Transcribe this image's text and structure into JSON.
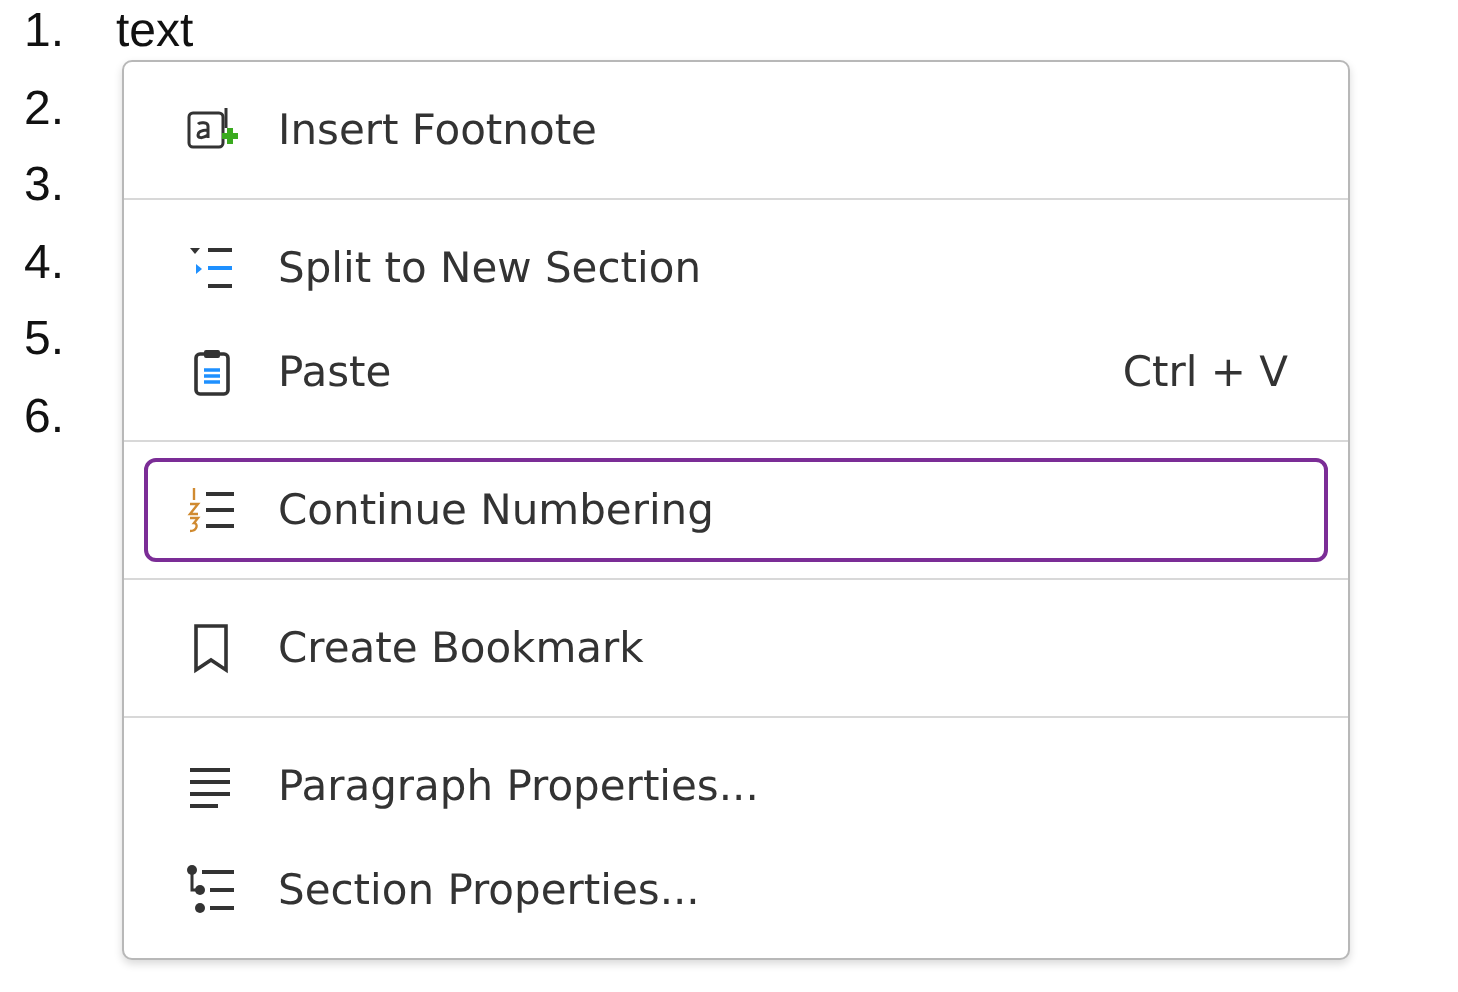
{
  "document": {
    "list": [
      {
        "number": "1.",
        "text": "text"
      },
      {
        "number": "2."
      },
      {
        "number": "3."
      },
      {
        "number": "4."
      },
      {
        "number": "5."
      },
      {
        "number": "6."
      }
    ]
  },
  "context_menu": {
    "groups": [
      [
        {
          "label": "Insert Footnote",
          "selected": false
        }
      ],
      [
        {
          "label": "Split to New Section",
          "selected": false
        },
        {
          "label": "Paste",
          "shortcut": "Ctrl + V",
          "selected": false
        }
      ],
      [
        {
          "label": "Continue Numbering",
          "selected": true
        }
      ],
      [
        {
          "label": "Create Bookmark",
          "selected": false
        }
      ],
      [
        {
          "label": "Paragraph Properties...",
          "selected": false
        },
        {
          "label": "Section Properties...",
          "selected": false
        }
      ]
    ]
  }
}
